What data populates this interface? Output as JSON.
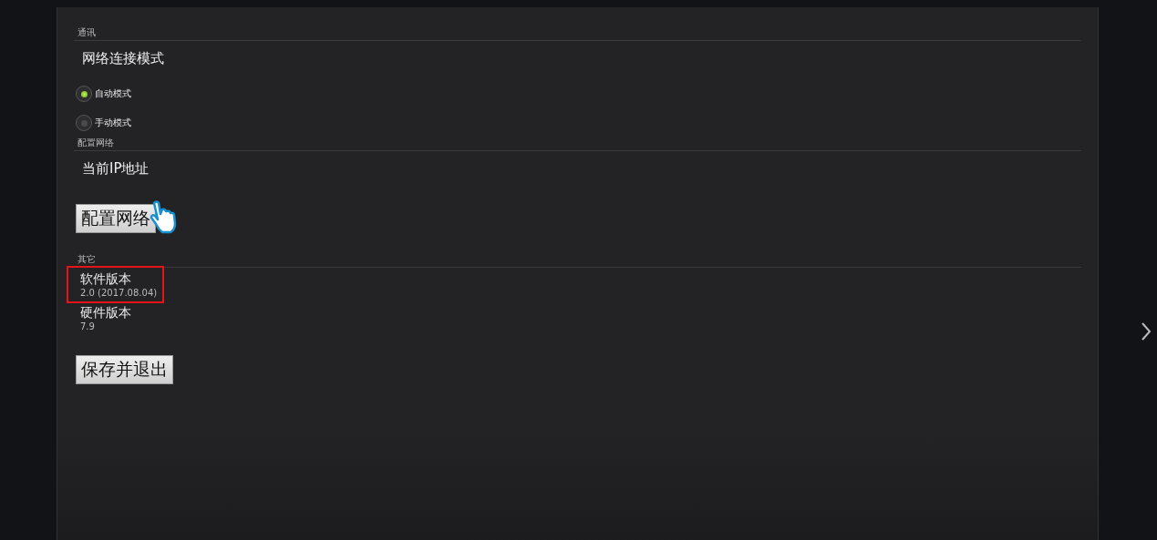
{
  "sections": [
    {
      "kind": "radios",
      "header": "通讯",
      "title": "网络连接模式",
      "options": [
        {
          "label": "自动模式",
          "selected": true
        },
        {
          "label": "手动模式",
          "selected": false
        }
      ]
    },
    {
      "kind": "action",
      "header": "配置网络",
      "title": "当前IP地址",
      "button": "配置网络"
    },
    {
      "kind": "info",
      "header": "其它",
      "items": [
        {
          "title": "软件版本",
          "value": "2.0 (2017.08.04)",
          "highlighted": true
        },
        {
          "title": "硬件版本",
          "value": "7.9",
          "highlighted": false
        }
      ],
      "button": "保存并退出"
    }
  ]
}
